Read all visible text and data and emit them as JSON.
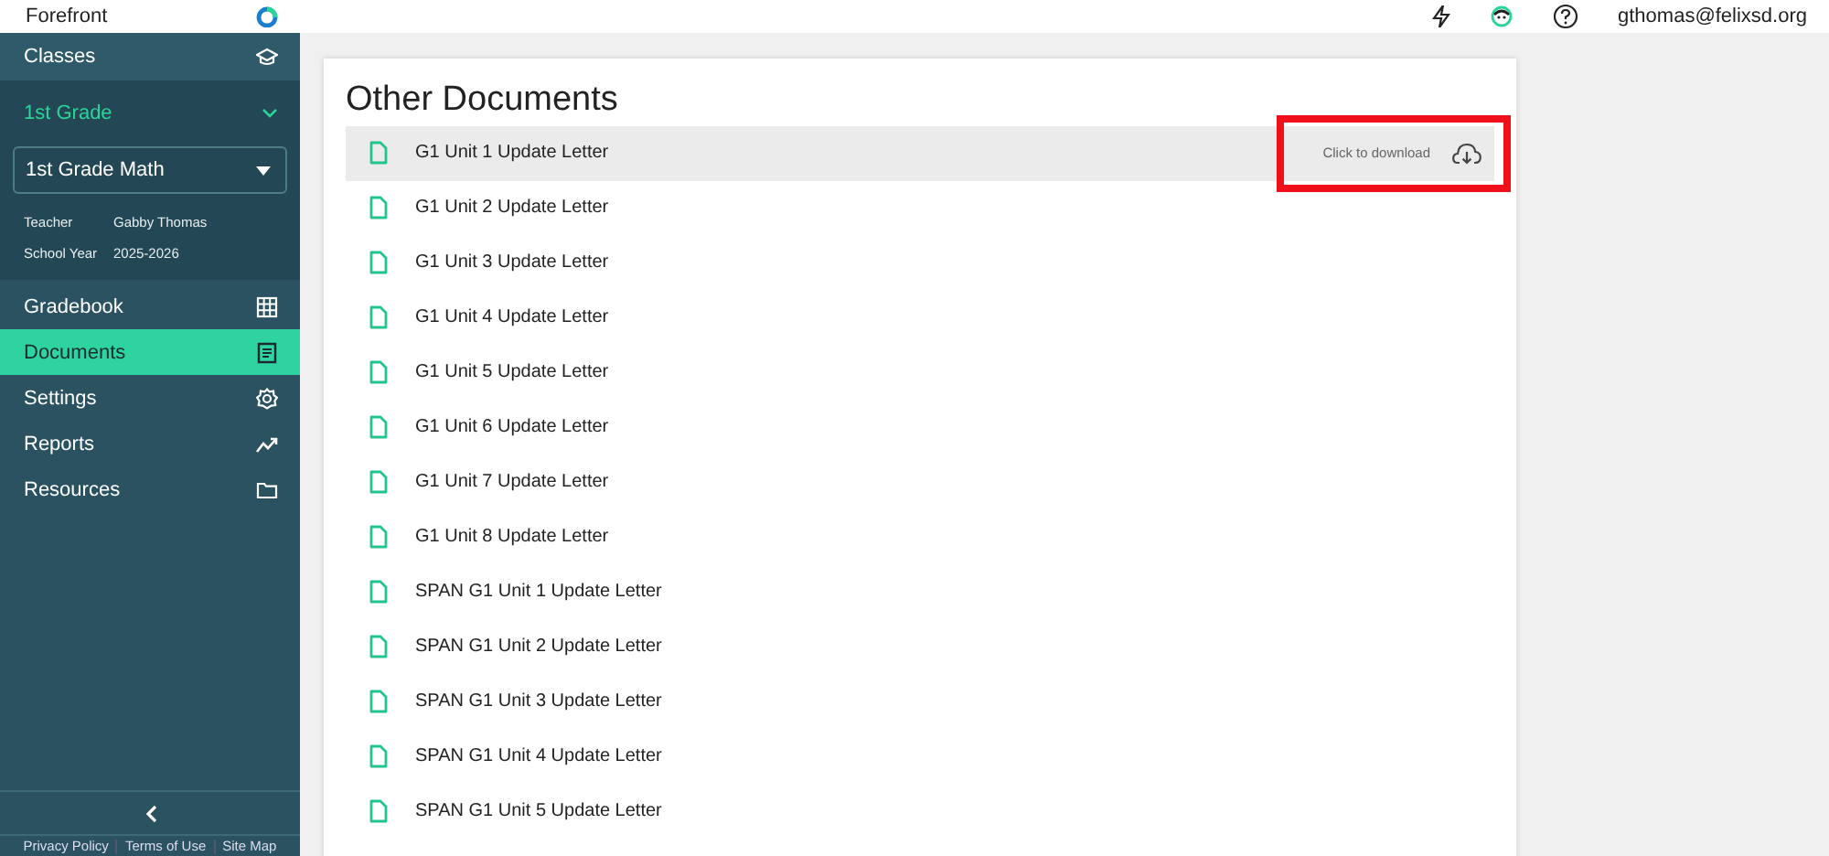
{
  "topbar": {
    "brand": "Forefront",
    "user": "gthomas@felixsd.org"
  },
  "sidebar": {
    "classes_label": "Classes",
    "grade": {
      "label": "1st Grade",
      "expanded": true
    },
    "class_select": "1st Grade Math",
    "info": [
      {
        "label": "Teacher",
        "value": "Gabby Thomas"
      },
      {
        "label": "School Year",
        "value": "2025-2026"
      }
    ],
    "items": [
      {
        "label": "Gradebook",
        "kind": "grid",
        "selected": false
      },
      {
        "label": "Documents",
        "kind": "doc",
        "selected": true
      },
      {
        "label": "Settings",
        "kind": "gear",
        "selected": false
      },
      {
        "label": "Reports",
        "kind": "chart",
        "selected": false
      },
      {
        "label": "Resources",
        "kind": "folder",
        "selected": false
      }
    ],
    "footer_links": [
      "Privacy Policy",
      "Terms of Use",
      "Site Map"
    ]
  },
  "documents": {
    "title": "Other Documents",
    "items": [
      {
        "name": "G1 Unit 1 Update Letter",
        "hovered": true,
        "hint": "Click to download",
        "highlighted": true
      },
      {
        "name": "G1 Unit 2 Update Letter",
        "hovered": false
      },
      {
        "name": "G1 Unit 3 Update Letter",
        "hovered": false
      },
      {
        "name": "G1 Unit 4 Update Letter",
        "hovered": false
      },
      {
        "name": "G1 Unit 5 Update Letter",
        "hovered": false
      },
      {
        "name": "G1 Unit 6 Update Letter",
        "hovered": false
      },
      {
        "name": "G1 Unit 7 Update Letter",
        "hovered": false
      },
      {
        "name": "G1 Unit 8 Update Letter",
        "hovered": false
      },
      {
        "name": "SPAN G1 Unit 1 Update Letter",
        "hovered": false
      },
      {
        "name": "SPAN G1 Unit 2 Update Letter",
        "hovered": false
      },
      {
        "name": "SPAN G1 Unit 3 Update Letter",
        "hovered": false
      },
      {
        "name": "SPAN G1 Unit 4 Update Letter",
        "hovered": false
      },
      {
        "name": "SPAN G1 Unit 5 Update Letter",
        "hovered": false
      }
    ]
  }
}
